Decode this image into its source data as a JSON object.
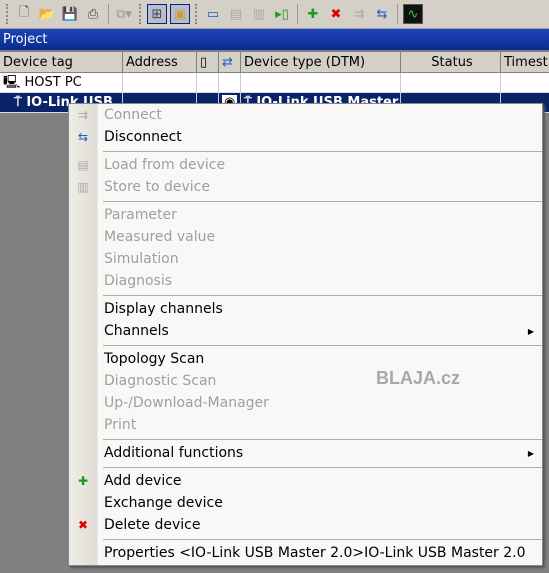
{
  "toolbar": {
    "icons": [
      "new-icon",
      "open-icon",
      "save-icon",
      "print-icon",
      "copy-icon",
      "network-view-icon",
      "catalog-icon",
      "window-icon",
      "load-icon",
      "store-icon",
      "data-icon",
      "add-device-icon",
      "delete-device-icon",
      "connect-icon",
      "disconnect-icon",
      "monitor-icon"
    ]
  },
  "project": {
    "title": "Project"
  },
  "grid": {
    "columns": [
      "Device tag",
      "Address",
      "",
      "",
      "Device type (DTM)",
      "Status",
      "Timest"
    ],
    "rows": [
      {
        "tag": "HOST PC",
        "icon": "computer-icon"
      },
      {
        "tag": "IO-Link USB",
        "type": "IO-Link USB Master",
        "selected": true,
        "icon": "usb-master-icon"
      }
    ]
  },
  "menu": {
    "items": [
      {
        "label": "Connect",
        "disabled": true,
        "icon": "connect-icon"
      },
      {
        "label": "Disconnect",
        "disabled": false,
        "icon": "disconnect-icon"
      },
      {
        "sep": true
      },
      {
        "label": "Load from device",
        "disabled": true,
        "icon": "load-icon"
      },
      {
        "label": "Store to device",
        "disabled": true,
        "icon": "store-icon"
      },
      {
        "sep": true
      },
      {
        "label": "Parameter",
        "disabled": true
      },
      {
        "label": "Measured value",
        "disabled": true
      },
      {
        "label": "Simulation",
        "disabled": true
      },
      {
        "label": "Diagnosis",
        "disabled": true
      },
      {
        "sep": true
      },
      {
        "label": "Display channels",
        "disabled": false
      },
      {
        "label": "Channels",
        "disabled": false,
        "submenu": true
      },
      {
        "sep": true
      },
      {
        "label": "Topology Scan",
        "disabled": false
      },
      {
        "label": "Diagnostic Scan",
        "disabled": true
      },
      {
        "label": "Up-/Download-Manager",
        "disabled": true
      },
      {
        "label": "Print",
        "disabled": true
      },
      {
        "sep": true
      },
      {
        "label": "Additional functions",
        "disabled": false,
        "submenu": true
      },
      {
        "sep": true
      },
      {
        "label": "Add device",
        "disabled": false,
        "icon": "add-device-icon"
      },
      {
        "label": "Exchange device",
        "disabled": false
      },
      {
        "label": "Delete device",
        "disabled": false,
        "icon": "delete-device-icon"
      },
      {
        "sep": true
      },
      {
        "label": "Properties <IO-Link USB Master 2.0>IO-Link USB Master 2.0",
        "disabled": false
      }
    ]
  },
  "watermark": "BLAJA.cz"
}
